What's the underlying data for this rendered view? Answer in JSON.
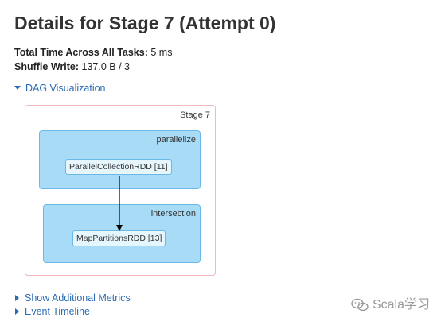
{
  "page": {
    "title": "Details for Stage 7 (Attempt 0)"
  },
  "summary": {
    "total_time_label": "Total Time Across All Tasks:",
    "total_time_value": "5 ms",
    "shuffle_write_label": "Shuffle Write:",
    "shuffle_write_value": "137.0 B / 3"
  },
  "dag": {
    "toggle_label": "DAG Visualization",
    "expanded": true,
    "stage_label": "Stage 7",
    "clusters": [
      {
        "label": "parallelize",
        "node": "ParallelCollectionRDD [11]"
      },
      {
        "label": "intersection",
        "node": "MapPartitionsRDD [13]"
      }
    ],
    "colors": {
      "cluster_fill": "#a8dcf6",
      "cluster_border": "#6ab9e6",
      "node_fill": "#e6f6fd",
      "stage_border": "#f2b8bd",
      "link": "#2a6bb3"
    }
  },
  "links": {
    "additional_metrics": "Show Additional Metrics",
    "event_timeline": "Event Timeline"
  },
  "watermark": {
    "text": "Scala学习",
    "icon": "wechat-icon"
  }
}
